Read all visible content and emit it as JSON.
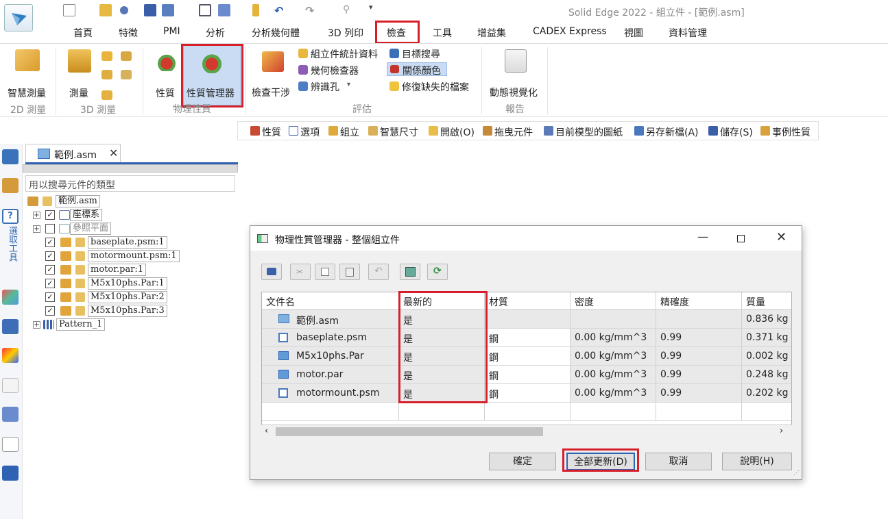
{
  "window": {
    "title": "Solid Edge 2022 - 組立件 - [範例.asm]"
  },
  "tabs": [
    "首頁",
    "特徵",
    "PMI",
    "分析",
    "分析幾何體",
    "3D 列印",
    "檢查",
    "工具",
    "增益集",
    "CADEX Express",
    "視圖",
    "資料管理"
  ],
  "ribbon": {
    "smart_measure": "智慧測量",
    "group_2d": "2D 測量",
    "measure": "測量",
    "group_3d": "3D 測量",
    "properties": "性質",
    "prop_manager": "性質管理器",
    "group_physical": "物理性質",
    "interference": "檢查干涉",
    "asm_stats": "組立件統計資料",
    "geom_inspector": "幾何檢查器",
    "identify_holes": "辨識孔",
    "target_search": "目標搜尋",
    "relation_color": "關係顏色",
    "fix_missing": "修復缺失的檔案",
    "group_evaluate": "評估",
    "dynamic_vis": "動態視覺化",
    "group_report": "報告"
  },
  "cmdbar": [
    "性質",
    "選項",
    "組立",
    "智慧尺寸",
    "開啟(O)",
    "拖曳元件",
    "目前模型的圖紙",
    "另存新檔(A)",
    "儲存(S)",
    "事例性質"
  ],
  "doc_tab": "範例.asm",
  "pathfinder": {
    "search_placeholder": "用以搜尋元件的類型",
    "root": "範例.asm",
    "items": [
      "座標系",
      "參照平面",
      "baseplate.psm:1",
      "motormount.psm:1",
      "motor.par:1",
      "M5x10phs.Par:1",
      "M5x10phs.Par:2",
      "M5x10phs.Par:3",
      "Pattern_1"
    ],
    "left_tool_label": "選取工具"
  },
  "dialog": {
    "title": "物理性質管理器 - 整個組立件",
    "columns": [
      "文件名",
      "最新的",
      "材質",
      "密度",
      "精確度",
      "質量"
    ],
    "rows": [
      [
        "範例.asm",
        "是",
        "",
        "",
        "",
        "0.836 kg"
      ],
      [
        "baseplate.psm",
        "是",
        "鋼",
        "0.00 kg/mm^3",
        "0.99",
        "0.371 kg"
      ],
      [
        "M5x10phs.Par",
        "是",
        "鋼",
        "0.00 kg/mm^3",
        "0.99",
        "0.002 kg"
      ],
      [
        "motor.par",
        "是",
        "鋼",
        "0.00 kg/mm^3",
        "0.99",
        "0.248 kg"
      ],
      [
        "motormount.psm",
        "是",
        "鋼",
        "0.00 kg/mm^3",
        "0.99",
        "0.202 kg"
      ]
    ],
    "buttons": {
      "ok": "確定",
      "update_all": "全部更新(D)",
      "cancel": "取消",
      "help": "說明(H)"
    }
  }
}
